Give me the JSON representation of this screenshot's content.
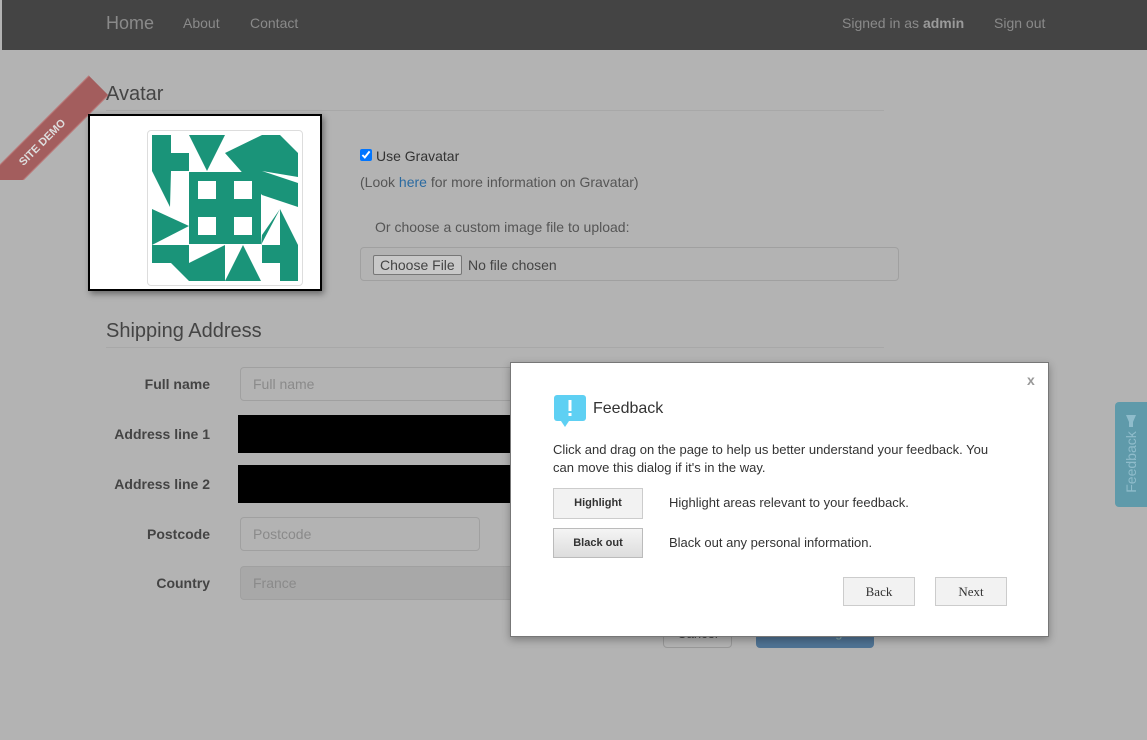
{
  "nav": {
    "home": "Home",
    "about": "About",
    "contact": "Contact",
    "signed_in_prefix": "Signed in as ",
    "user": "admin",
    "sign_out": "Sign out"
  },
  "ribbon": "SITE DEMO",
  "avatar": {
    "title": "Avatar",
    "use_gravatar": "Use Gravatar",
    "use_gravatar_checked": true,
    "info_prefix": "(Look ",
    "info_link": "here",
    "info_suffix": " for more information on Gravatar)",
    "custom_label": "Or choose a custom image file to upload:",
    "choose_file": "Choose File",
    "no_file": "No file chosen",
    "identicon_color": "#1a9479"
  },
  "shipping": {
    "title": "Shipping Address",
    "full_name_label": "Full name",
    "full_name_placeholder": "Full name",
    "address1_label": "Address line 1",
    "address2_label": "Address line 2",
    "postcode_label": "Postcode",
    "postcode_placeholder": "Postcode",
    "country_label": "Country",
    "country_value": "France",
    "cancel": "Cancel",
    "save": "Save changes"
  },
  "feedback": {
    "title": "Feedback",
    "close": "x",
    "intro": "Click and drag on the page to help us better understand your feedback. You can move this dialog if it's in the way.",
    "highlight_btn": "Highlight",
    "highlight_desc": "Highlight areas relevant to your feedback.",
    "blackout_btn": "Black out",
    "blackout_desc": "Black out any personal information.",
    "back": "Back",
    "next": "Next",
    "tab": "Feedback"
  }
}
